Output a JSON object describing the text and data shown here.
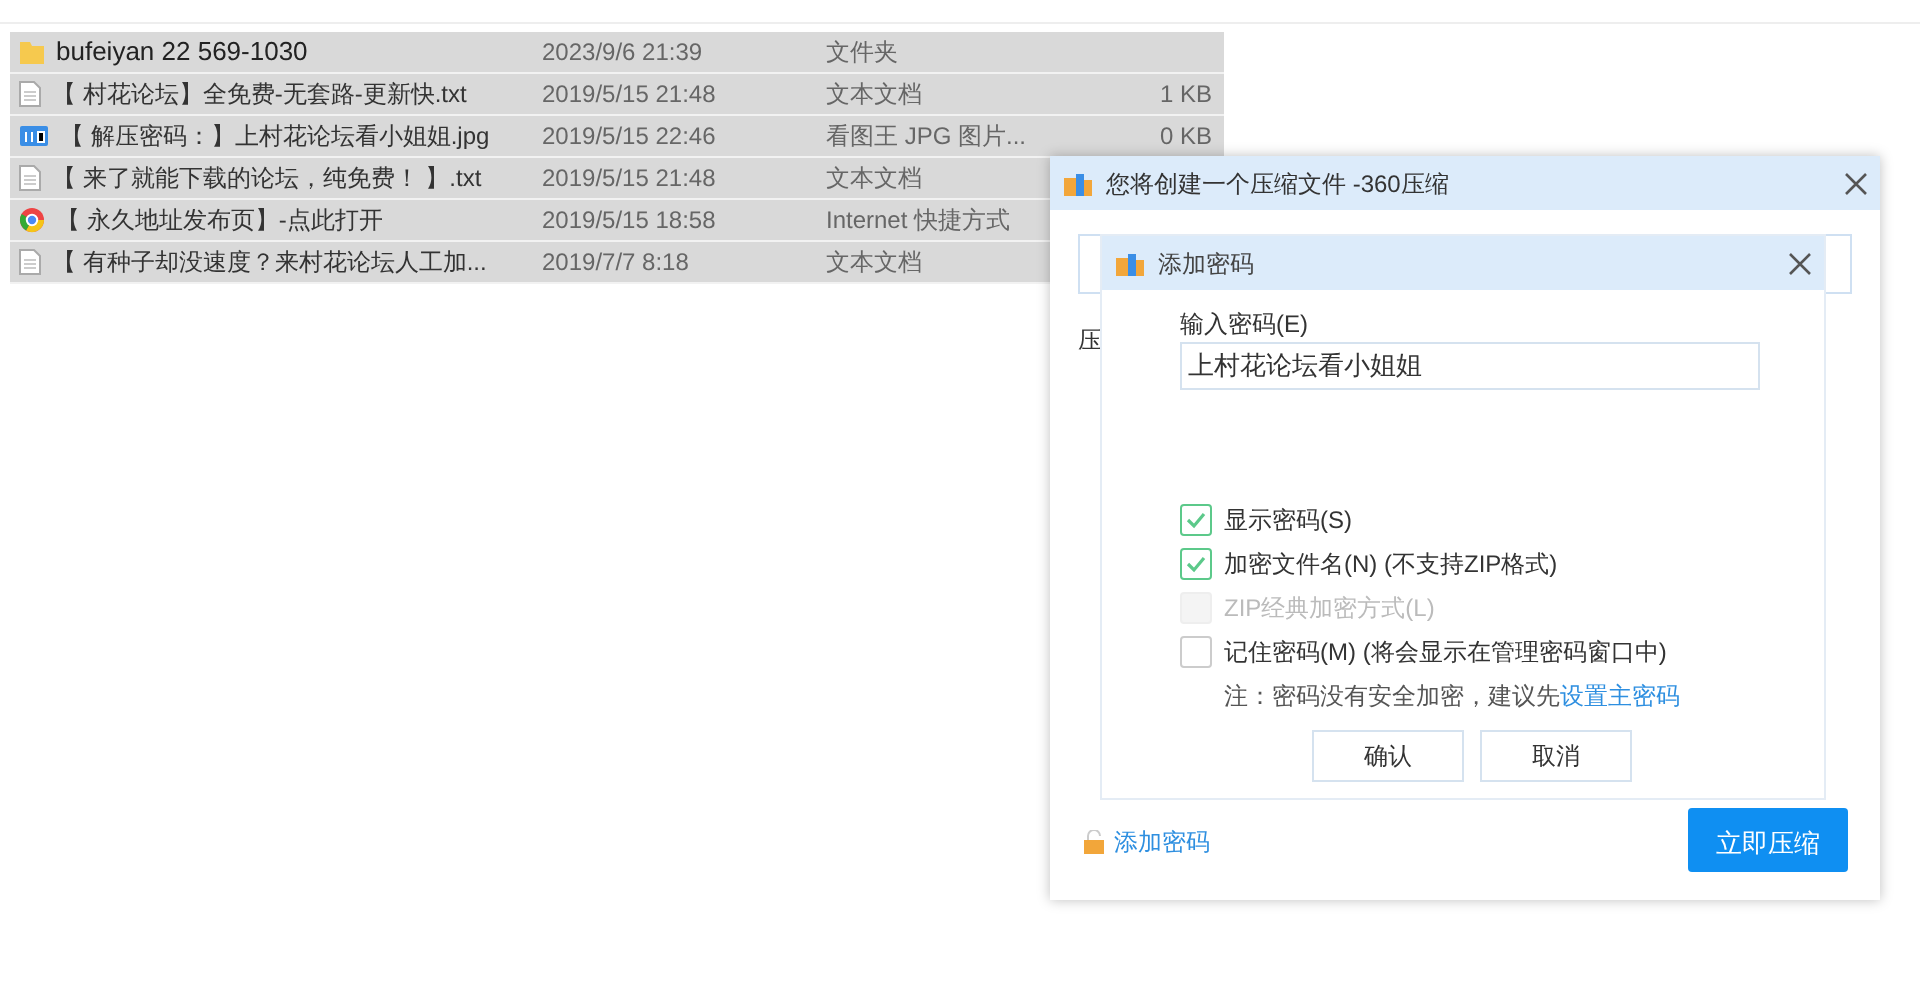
{
  "files": [
    {
      "kind": "folder",
      "name": "bufeiyan 22  569-1030",
      "date": "2023/9/6 21:39",
      "type": "文件夹"
    },
    {
      "kind": "text",
      "name": "【 村花论坛】全免费-无套路-更新快.txt",
      "date": "2019/5/15 21:48",
      "type": "文本文档",
      "size": "1 KB"
    },
    {
      "kind": "image",
      "name": "【 解压密码：】上村花论坛看小姐姐.jpg",
      "date": "2019/5/15 22:46",
      "type": "看图王 JPG 图片...",
      "size": "0 KB"
    },
    {
      "kind": "text",
      "name": "【 来了就能下载的论坛，纯免费！ 】.txt",
      "date": "2019/5/15 21:48",
      "type": "文本文档"
    },
    {
      "kind": "web",
      "name": "【 永久地址发布页】-点此打开",
      "date": "2019/5/15 18:58",
      "type": "Internet 快捷方式"
    },
    {
      "kind": "text",
      "name": "【 有种子却没速度？来村花论坛人工加...",
      "date": "2019/7/7 8:18",
      "type": "文本文档"
    }
  ],
  "outer_dialog": {
    "title": "您将创建一个压缩文件 -360压缩",
    "label": "压",
    "add_password_link": "添加密码",
    "compress_button": "立即压缩"
  },
  "password_dialog": {
    "title": "添加密码",
    "field_label": "输入密码(E)",
    "password": "上村花论坛看小姐姐",
    "options": [
      {
        "label": "显示密码(S)",
        "checked": true,
        "disabled": false
      },
      {
        "label": "加密文件名(N) (不支持ZIP格式)",
        "checked": true,
        "disabled": false
      },
      {
        "label": "ZIP经典加密方式(L)",
        "checked": false,
        "disabled": true
      },
      {
        "label": "记住密码(M) (将会显示在管理密码窗口中)",
        "checked": false,
        "disabled": false
      }
    ],
    "note": "注：密码没有安全加密，建议先",
    "note_link": "设置主密码",
    "buttons": [
      "确认",
      "取消"
    ]
  }
}
